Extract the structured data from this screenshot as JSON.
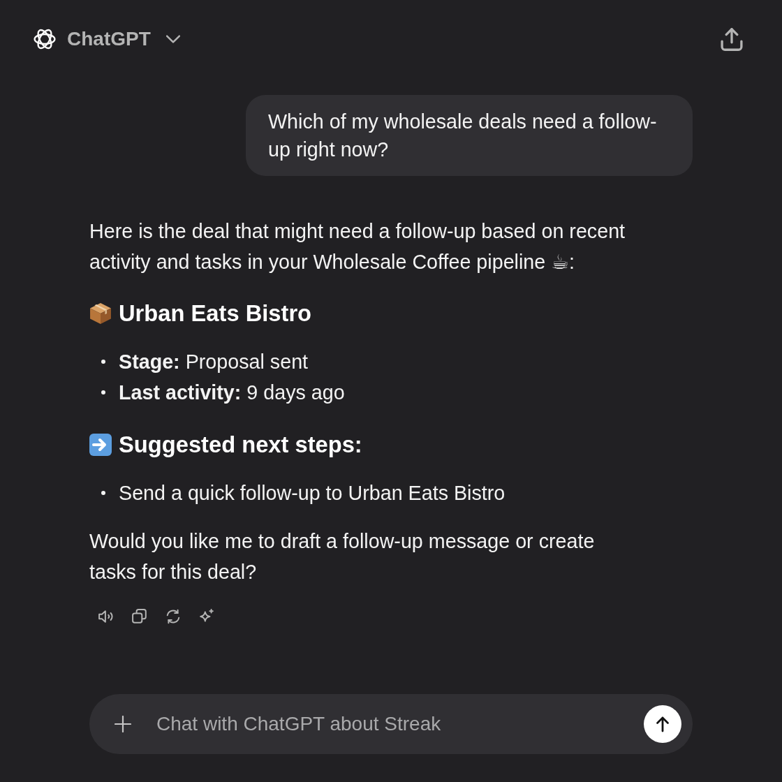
{
  "header": {
    "title": "ChatGPT"
  },
  "user_message": "Which of my wholesale deals need a follow-up right now?",
  "reply": {
    "intro": "Here is the deal that might need a follow-up based on recent activity and tasks in your Wholesale Coffee pipeline ☕:",
    "deal": {
      "title": "Urban Eats Bistro",
      "details": [
        "**Stage:** Proposal sent",
        "**Last activity:** 9 days ago"
      ]
    },
    "next_steps": {
      "title": "Suggested next steps:",
      "items": [
        "Send a quick follow-up to Urban Eats Bistro"
      ]
    },
    "closing": "Would you like me to draft a follow-up message or create tasks for this deal?"
  },
  "composer": {
    "placeholder": "Chat with ChatGPT about Streak"
  }
}
